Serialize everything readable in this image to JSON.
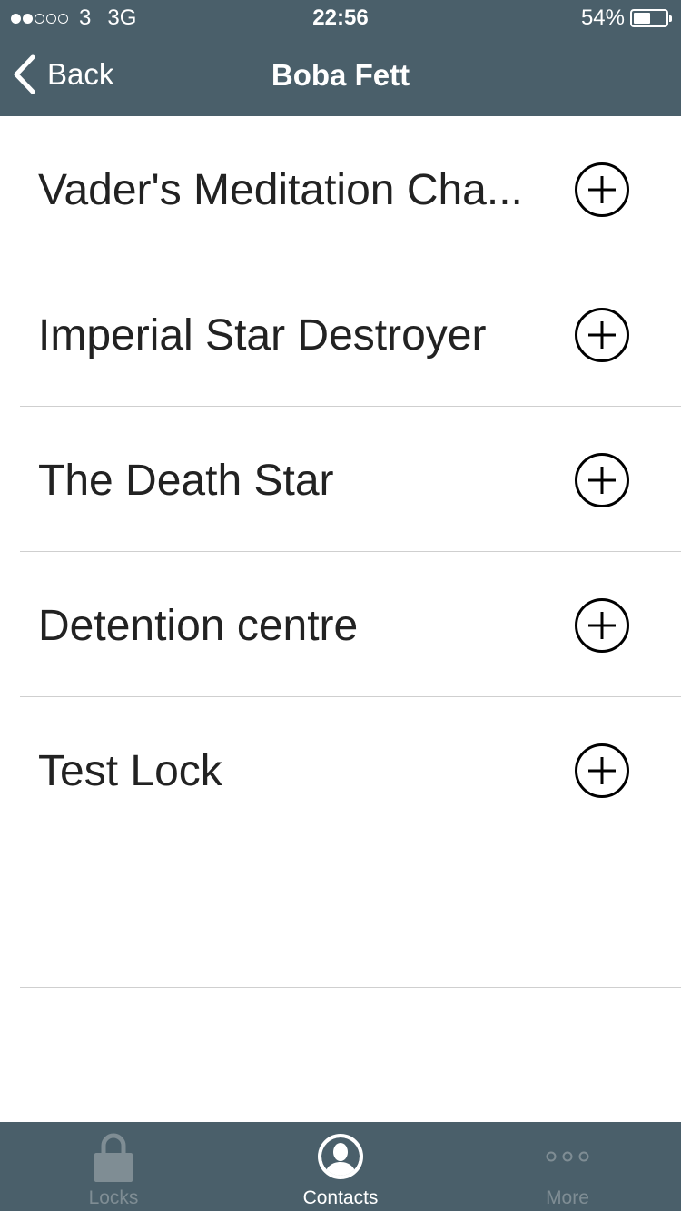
{
  "status_bar": {
    "carrier": "3",
    "network": "3G",
    "time": "22:56",
    "battery": "54%",
    "battery_level": 0.54,
    "signal_bars": 2,
    "signal_total": 5
  },
  "nav": {
    "back_label": "Back",
    "title": "Boba Fett"
  },
  "locks": [
    {
      "name": "Vader's Meditation Cha..."
    },
    {
      "name": "Imperial Star Destroyer"
    },
    {
      "name": "The Death Star"
    },
    {
      "name": "Detention centre"
    },
    {
      "name": "Test Lock"
    },
    {
      "name": ""
    }
  ],
  "tabs": [
    {
      "label": "Locks",
      "icon": "lock-icon",
      "active": false
    },
    {
      "label": "Contacts",
      "icon": "contact-icon",
      "active": true
    },
    {
      "label": "More",
      "icon": "more-dots-icon",
      "active": false
    }
  ],
  "colors": {
    "bar_background": "#4a5f6a",
    "tab_inactive": "#7f8d94",
    "tab_active": "#ffffff",
    "separator": "#cfcfcf",
    "row_text": "#222222"
  }
}
